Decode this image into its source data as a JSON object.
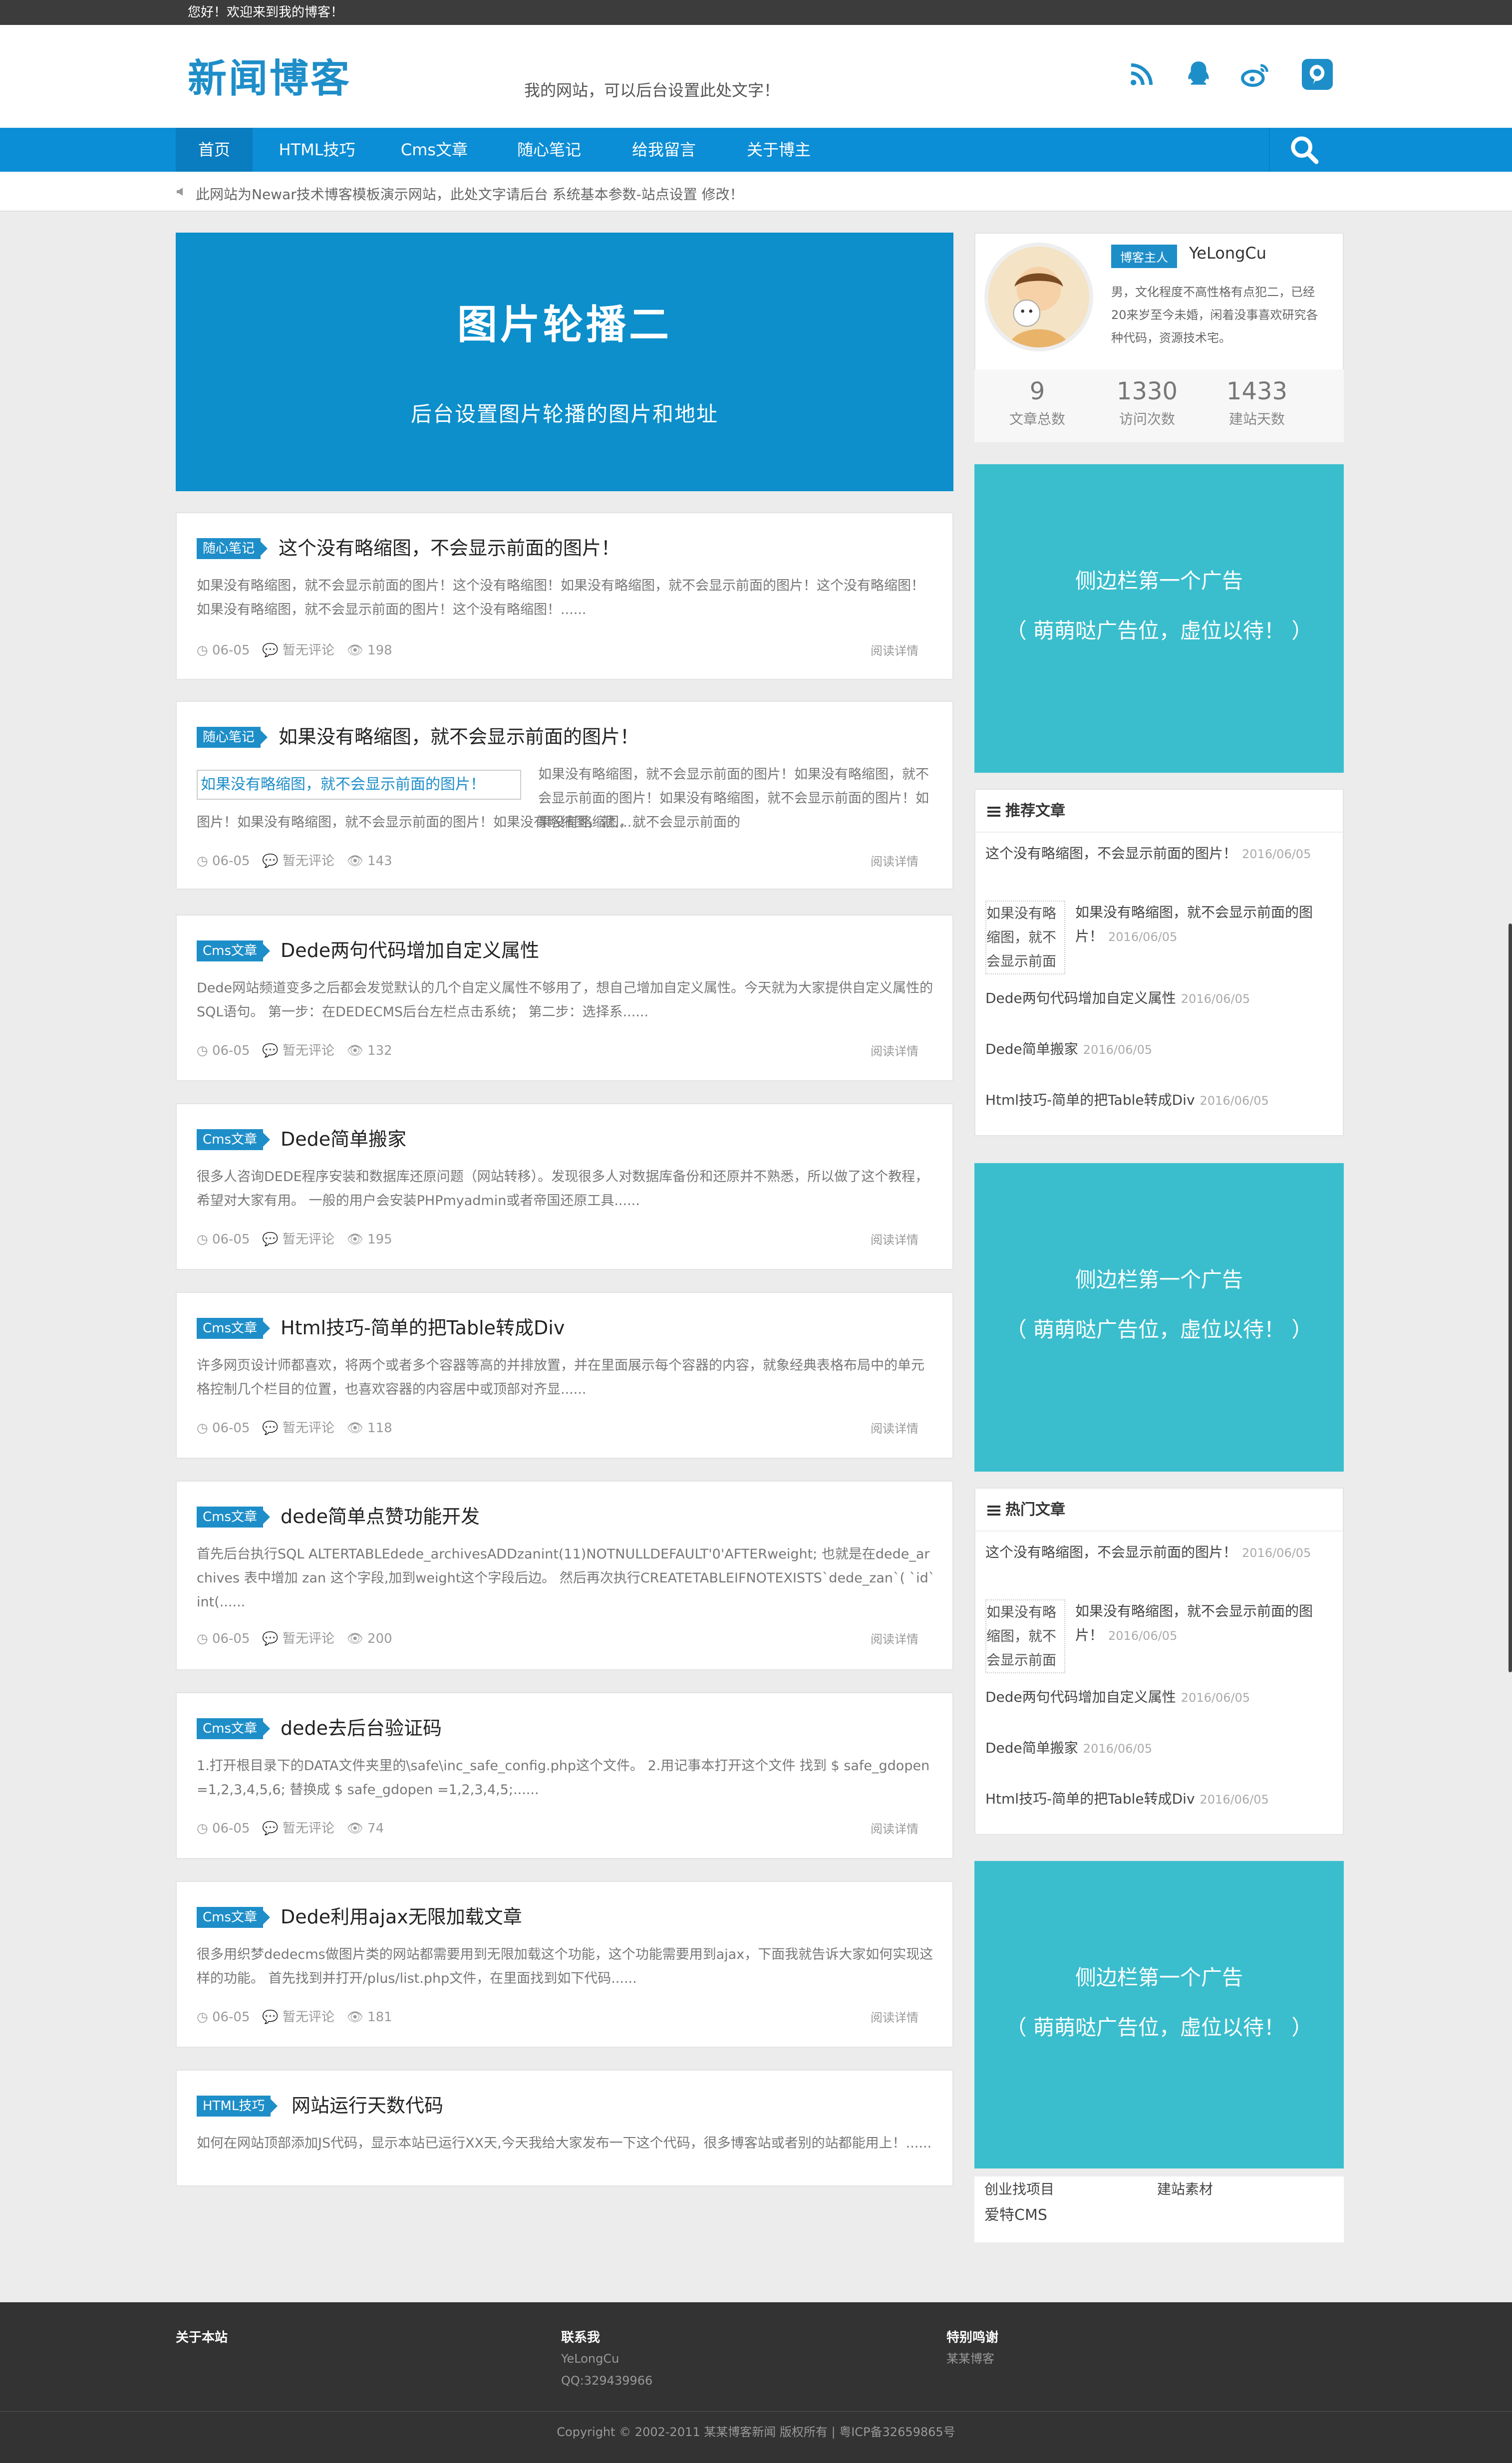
{
  "topbar": {
    "greeting": "您好！欢迎来到我的博客！"
  },
  "header": {
    "logo": "新闻博客",
    "slogan": "我的网站，可以后台设置此处文字！",
    "icons": [
      "rss-icon",
      "qq-icon",
      "weibo-icon",
      "pinterest-icon"
    ]
  },
  "nav": {
    "items": [
      "首页",
      "HTML技巧",
      "Cms文章",
      "随心笔记",
      "给我留言",
      "关于博主"
    ]
  },
  "notice": {
    "text": "此网站为Newar技术博客模板演示网站，此处文字请后台 系统基本参数-站点设置 修改！"
  },
  "banner": {
    "title": "图片轮播二",
    "subtitle": "后台设置图片轮播的图片和地址"
  },
  "posts": [
    {
      "tag": "随心笔记",
      "title": "这个没有略缩图，不会显示前面的图片！",
      "excerpt": "如果没有略缩图，就不会显示前面的图片！这个没有略缩图！如果没有略缩图，就不会显示前面的图片！这个没有略缩图！如果没有略缩图，就不会显示前面的图片！这个没有略缩图！......",
      "date": "06-05",
      "comments": "暂无评论",
      "views": "198",
      "more": "阅读详情"
    },
    {
      "tag": "随心笔记",
      "title": "如果没有略缩图，就不会显示前面的图片！",
      "thumb": "如果没有略缩图，就不会显示前面的图片！",
      "excerpt1": "如果没有略缩图，就不会显示前面的图片！如果没有略缩图，就不会显示前面的图片！如果没有略缩图，就不会显示前面的图片！如果没有略缩图，就不会显示前面的",
      "excerpt2": "图片！如果没有略缩图，就不会显示前面的图片！如果没有略缩图，就......",
      "date": "06-05",
      "comments": "暂无评论",
      "views": "143",
      "more": "阅读详情"
    },
    {
      "tag": "Cms文章",
      "title": "Dede两句代码增加自定义属性",
      "excerpt": "Dede网站频道变多之后都会发觉默认的几个自定义属性不够用了，想自己增加自定义属性。今天就为大家提供自定义属性的SQL语句。 第一步：在DEDECMS后台左栏点击系统； 第二步：选择系......",
      "date": "06-05",
      "comments": "暂无评论",
      "views": "132",
      "more": "阅读详情"
    },
    {
      "tag": "Cms文章",
      "title": "Dede简单搬家",
      "excerpt": "很多人咨询DEDE程序安装和数据库还原问题（网站转移）。发现很多人对数据库备份和还原并不熟悉，所以做了这个教程，希望对大家有用。 一般的用户会安装PHPmyadmin或者帝国还原工具......",
      "date": "06-05",
      "comments": "暂无评论",
      "views": "195",
      "more": "阅读详情"
    },
    {
      "tag": "Cms文章",
      "title": "Html技巧-简单的把Table转成Div",
      "excerpt": "许多网页设计师都喜欢，将两个或者多个容器等高的并排放置，并在里面展示每个容器的内容，就象经典表格布局中的单元格控制几个栏目的位置，也喜欢容器的内容居中或顶部对齐显......",
      "date": "06-05",
      "comments": "暂无评论",
      "views": "118",
      "more": "阅读详情"
    },
    {
      "tag": "Cms文章",
      "title": "dede简单点赞功能开发",
      "excerpt": "首先后台执行SQL ALTERTABLEdede_archivesADDzanint(11)NOTNULLDEFAULT'0'AFTERweight; 也就是在dede_archives 表中增加 zan 这个字段,加到weight这个字段后边。 然后再次执行CREATETABLEIFNOTEXISTS`dede_zan`( `id`int(......",
      "date": "06-05",
      "comments": "暂无评论",
      "views": "200",
      "more": "阅读详情"
    },
    {
      "tag": "Cms文章",
      "title": "dede去后台验证码",
      "excerpt": "1.打开根目录下的DATA文件夹里的\\safe\\inc_safe_config.php这个文件。 2.用记事本打开这个文件 找到 $ safe_gdopen =1,2,3,4,5,6; 替换成 $ safe_gdopen =1,2,3,4,5;......",
      "date": "06-05",
      "comments": "暂无评论",
      "views": "74",
      "more": "阅读详情"
    },
    {
      "tag": "Cms文章",
      "title": "Dede利用ajax无限加载文章",
      "excerpt": "很多用织梦dedecms做图片类的网站都需要用到无限加载这个功能，这个功能需要用到ajax，下面我就告诉大家如何实现这样的功能。 首先找到并打开/plus/list.php文件，在里面找到如下代码......",
      "date": "06-05",
      "comments": "暂无评论",
      "views": "181",
      "more": "阅读详情"
    },
    {
      "tag": "HTML技巧",
      "title": "网站运行天数代码",
      "excerpt": "如何在网站顶部添加JS代码，显示本站已运行XX天,今天我给大家发布一下这个代码，很多博客站或者别的站都能用上！......"
    }
  ],
  "author": {
    "tag": "博客主人",
    "name": "YeLongCu",
    "bio": "男，文化程度不高性格有点犯二，已经20来岁至今未婚，闲着没事喜欢研究各种代码，资源技术宅。",
    "stats": [
      {
        "n": "9",
        "l": "文章总数"
      },
      {
        "n": "1330",
        "l": "访问次数"
      },
      {
        "n": "1433",
        "l": "建站天数"
      }
    ]
  },
  "ad": {
    "line1": "侧边栏第一个广告",
    "line2": "（ 萌萌哒广告位，虚位以待！ ）"
  },
  "recommend": {
    "title": "推荐文章",
    "items": [
      {
        "t": "这个没有略缩图，不会显示前面的图片！",
        "d": "2016/06/05"
      },
      {
        "thumb": "如果没有略缩图，就不会显示前面",
        "t": "如果没有略缩图，就不会显示前面的图片！",
        "d": "2016/06/05"
      },
      {
        "t": "Dede两句代码增加自定义属性",
        "d": "2016/06/05"
      },
      {
        "t": "Dede简单搬家",
        "d": "2016/06/05"
      },
      {
        "t": "Html技巧-简单的把Table转成Div",
        "d": "2016/06/05"
      }
    ]
  },
  "hot": {
    "title": "热门文章",
    "items": [
      {
        "t": "这个没有略缩图，不会显示前面的图片！",
        "d": "2016/06/05"
      },
      {
        "thumb": "如果没有略缩图，就不会显示前面",
        "t": "如果没有略缩图，就不会显示前面的图片！",
        "d": "2016/06/05"
      },
      {
        "t": "Dede两句代码增加自定义属性",
        "d": "2016/06/05"
      },
      {
        "t": "Dede简单搬家",
        "d": "2016/06/05"
      },
      {
        "t": "Html技巧-简单的把Table转成Div",
        "d": "2016/06/05"
      }
    ]
  },
  "links": {
    "a": "创业找项目",
    "b": "建站素材",
    "c": "爱特CMS"
  },
  "footer": {
    "about": "关于本站",
    "contact": "联系我",
    "contact_name": "YeLongCu",
    "contact_qq": "QQ:329439966",
    "thanks": "特别鸣谢",
    "thanks_text": "某某博客",
    "copyright": "Copyright © 2002-2011 某某博客新闻 版权所有 | 粤ICP备32659865号"
  },
  "colors": {
    "brand": "#1e8ec9",
    "nav": "#0c8ed6",
    "ad": "#3abecd",
    "banner": "#0c8fcb"
  }
}
